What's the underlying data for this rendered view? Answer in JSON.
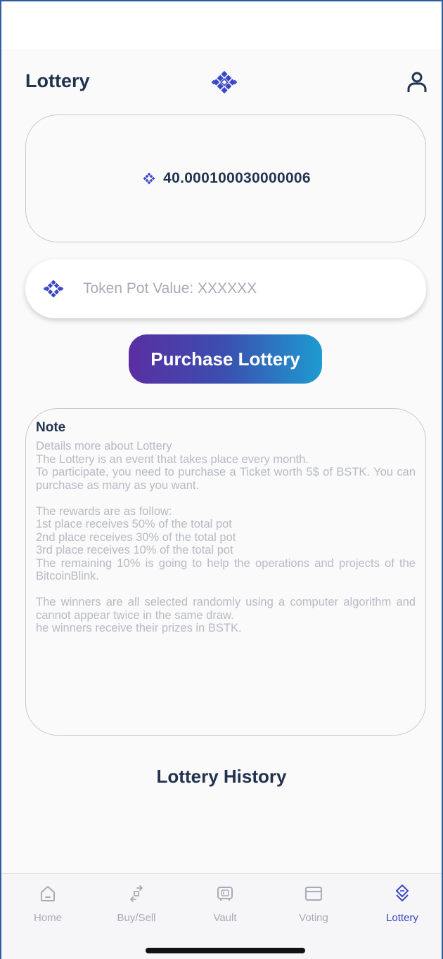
{
  "header": {
    "title": "Lottery"
  },
  "balance": {
    "value": "40.000100030000006"
  },
  "pot": {
    "placeholder": "Token Pot Value: XXXXXX"
  },
  "purchase_button": {
    "label": "Purchase Lottery"
  },
  "note": {
    "title": "Note",
    "paragraphs": [
      [
        "Details more about Lottery",
        "The Lottery is an event that takes place every month.",
        "To participate, you need to purchase a Ticket worth 5$ of BSTK. You can purchase as many as you want."
      ],
      [
        "The rewards are as follow:",
        "1st place receives 50% of the total pot",
        "2nd place receives 30% of the total pot",
        "3rd place receives 10% of the total pot",
        "The remaining 10% is going to help the operations and projects of the BitcoinBlink."
      ],
      [
        "The winners are all selected randomly using a computer algorithm and cannot appear twice in the same draw.",
        "he winners receive their prizes in BSTK."
      ]
    ]
  },
  "history": {
    "title": "Lottery History"
  },
  "bottom_nav": {
    "items": [
      {
        "label": "Home",
        "icon": "home-icon",
        "active": false
      },
      {
        "label": "Buy/Sell",
        "icon": "swap-icon",
        "active": false
      },
      {
        "label": "Vault",
        "icon": "vault-icon",
        "active": false
      },
      {
        "label": "Voting",
        "icon": "voting-icon",
        "active": false
      },
      {
        "label": "Lottery",
        "icon": "lottery-icon",
        "active": true
      }
    ]
  },
  "colors": {
    "brand": "#3b47c8",
    "title": "#22334f",
    "muted": "#a8abb7",
    "gradient_start": "#5a2ea3",
    "gradient_end": "#1e9bd0"
  }
}
